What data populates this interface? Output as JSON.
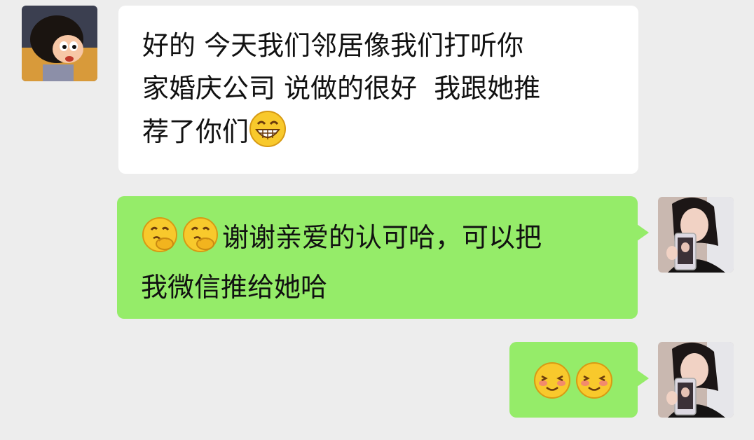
{
  "messages": [
    {
      "sender": "contact",
      "avatar_icon": "cartoon-girl-avatar-icon",
      "lines": [
        "好的 今天我们邻居像我们打听你",
        "家婚庆公司 说做的很好  我跟她推",
        "荐了你们"
      ],
      "trailing_emoji": "grin-emoji-icon"
    },
    {
      "sender": "me",
      "avatar_icon": "woman-selfie-avatar-icon",
      "leading_emojis": [
        "thinking-emoji-icon",
        "thinking-emoji-icon"
      ],
      "lines": [
        "谢谢亲爱的认可哈，可以把",
        "我微信推给她哈"
      ]
    },
    {
      "sender": "me",
      "avatar_icon": "woman-selfie-avatar-icon",
      "emojis": [
        "shy-smile-emoji-icon",
        "shy-smile-emoji-icon"
      ]
    }
  ],
  "colors": {
    "background": "#ededed",
    "incoming_bubble": "#ffffff",
    "outgoing_bubble": "#95ec69",
    "text": "#111111"
  }
}
